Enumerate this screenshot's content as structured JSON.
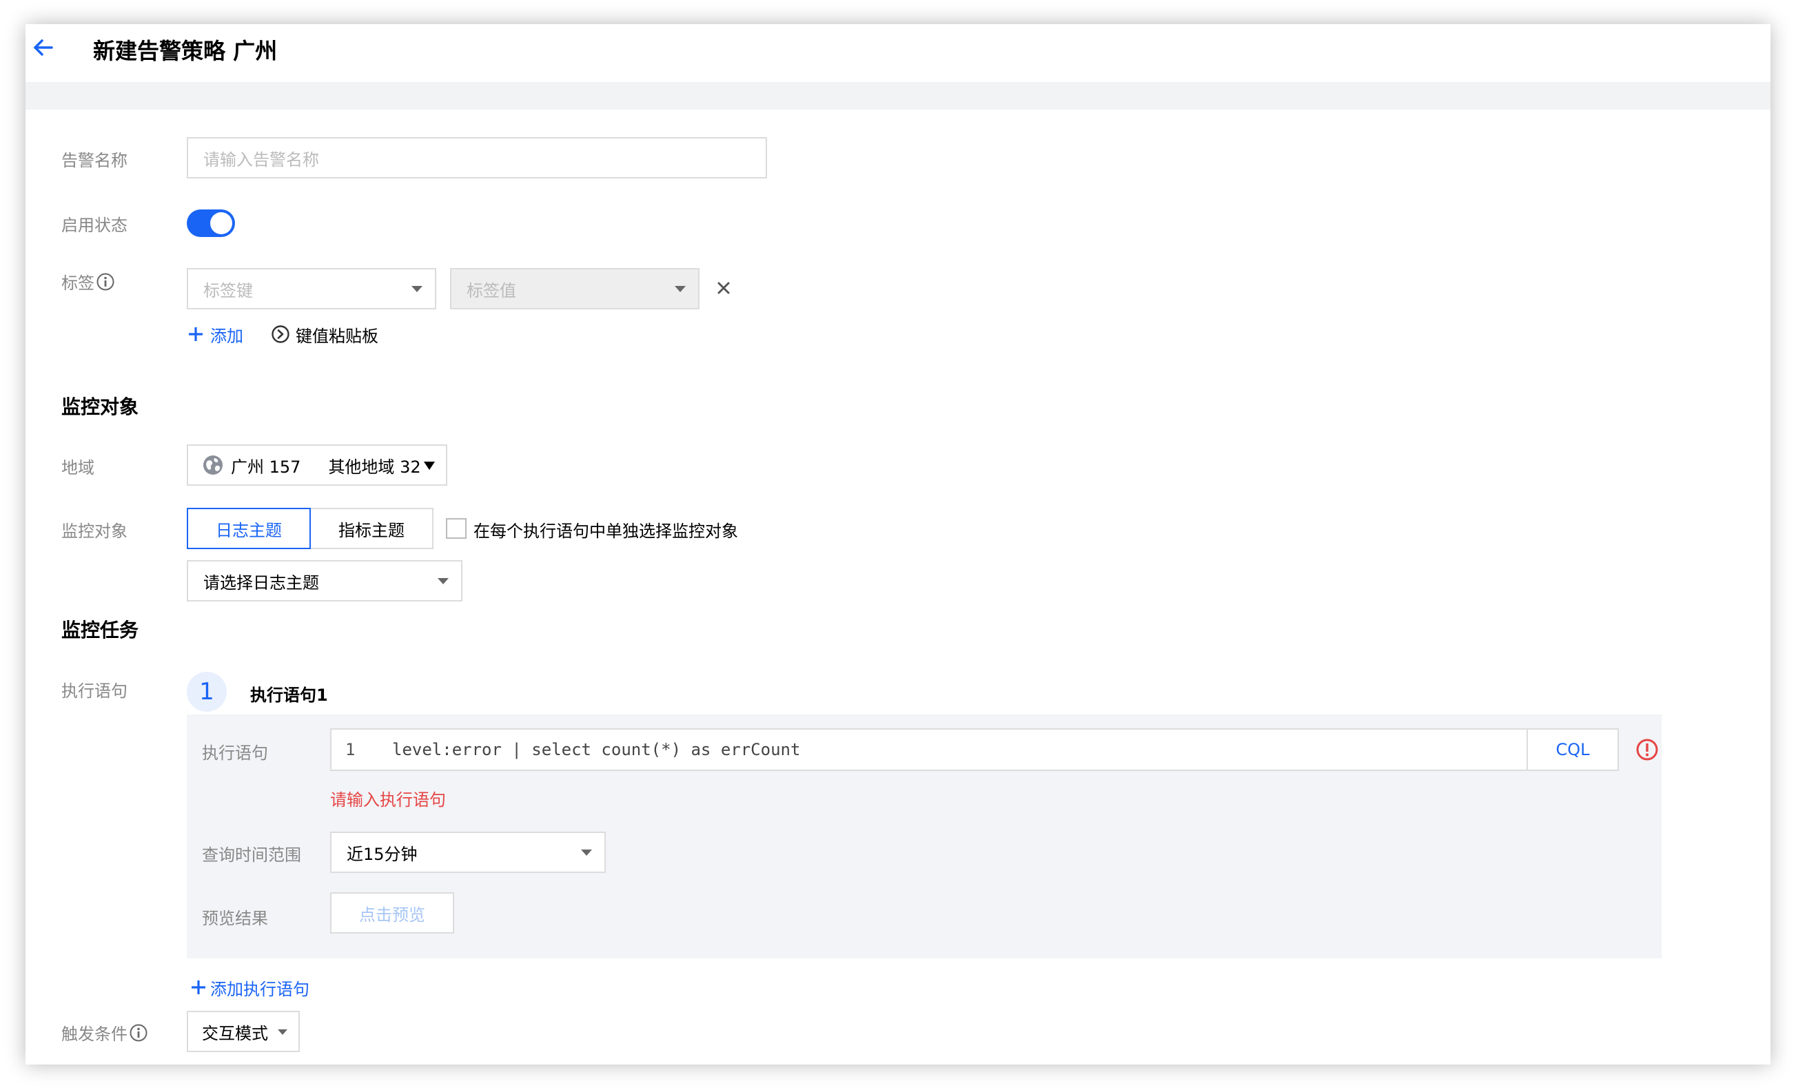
{
  "header": {
    "title": "新建告警策略 广州"
  },
  "form": {
    "alarm_name": {
      "label": "告警名称",
      "placeholder": "请输入告警名称"
    },
    "enable_status": {
      "label": "启用状态",
      "enabled": true
    },
    "tags": {
      "label": "标签",
      "key_placeholder": "标签键",
      "value_placeholder": "标签值",
      "add_label": "添加",
      "clipboard_label": "键值粘贴板"
    }
  },
  "monitor_object": {
    "section_title": "监控对象",
    "region": {
      "label": "地域",
      "primary": "广州 157",
      "other": "其他地域 32"
    },
    "object": {
      "label": "监控对象",
      "tabs": [
        {
          "label": "日志主题",
          "active": true
        },
        {
          "label": "指标主题",
          "active": false
        }
      ],
      "checkbox_label": "在每个执行语句中单独选择监控对象",
      "select_value": "请选择日志主题"
    }
  },
  "monitor_task": {
    "section_title": "监控任务",
    "statement_label": "执行语句",
    "step": {
      "number": "1",
      "title": "执行语句1"
    },
    "statement": {
      "label": "执行语句",
      "line_number": "1",
      "code": "level:error | select count(*) as errCount",
      "syntax_button": "CQL",
      "error": "请输入执行语句"
    },
    "time_range": {
      "label": "查询时间范围",
      "value": "近15分钟"
    },
    "preview": {
      "label": "预览结果",
      "button": "点击预览"
    },
    "add_statement": "添加执行语句"
  },
  "trigger": {
    "label": "触发条件",
    "mode": "交互模式"
  },
  "colors": {
    "primary": "#1a64f5",
    "error": "#e54545",
    "muted": "#888888"
  }
}
